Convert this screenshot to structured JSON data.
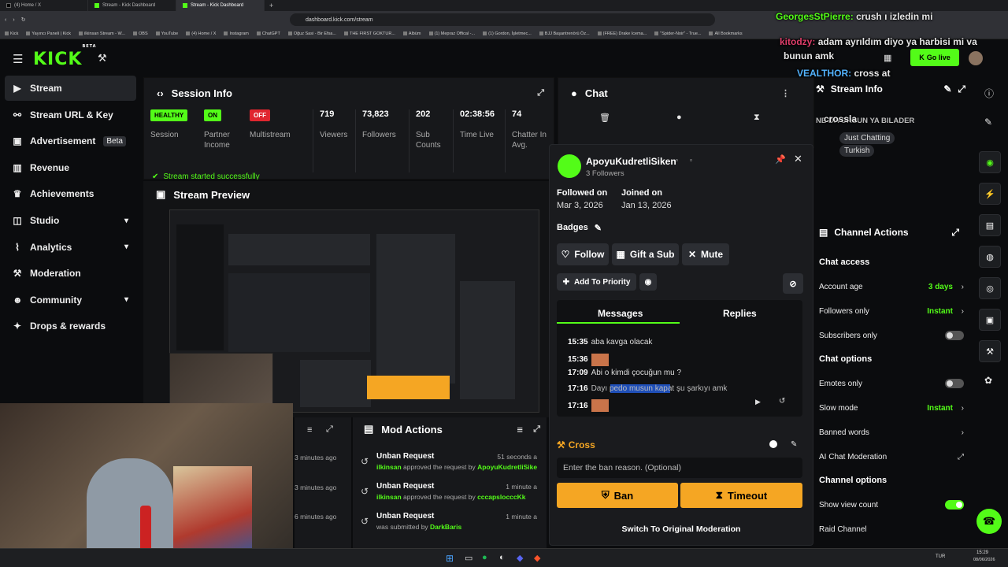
{
  "browser": {
    "tabs": [
      "(4) Home / X",
      "Stream - Kick Dashboard",
      "Stream - Kick Dashboard"
    ],
    "url": "dashboard.kick.com/stream",
    "bookmarks": [
      "Kick",
      "Yayıncı Paneli | Kick",
      "ilkinsan Stream - W...",
      "OBS",
      "YouTube",
      "(4) Home / X",
      "Instagram",
      "ChatGPT",
      "Oğuz Sasi - Bir Efsa...",
      "THE FIRST GOKTUR...",
      "Albüm",
      "(1) Mepraz Offical -...",
      "(1) Gordon, İşletmec...",
      "BJJ Başantrenörü Öz...",
      "(FREE) Drake Icema...",
      "\"Spider-Noir\" - True...",
      "All Bookmarks"
    ]
  },
  "header": {
    "logo": "KICK",
    "beta": "BETA",
    "go_live": "Go live"
  },
  "sidebar": {
    "items": [
      {
        "label": "Stream",
        "icon": "stream-icon",
        "glyph": "▶"
      },
      {
        "label": "Stream URL & Key",
        "icon": "link-icon",
        "glyph": "⚯"
      },
      {
        "label": "Advertisement",
        "icon": "advert-icon",
        "glyph": "▣",
        "badge": "Beta"
      },
      {
        "label": "Revenue",
        "icon": "revenue-icon",
        "glyph": "▥"
      },
      {
        "label": "Achievements",
        "icon": "trophy-icon",
        "glyph": "♛"
      },
      {
        "label": "Studio",
        "icon": "studio-icon",
        "glyph": "◫"
      },
      {
        "label": "Analytics",
        "icon": "analytics-icon",
        "glyph": "⌇"
      },
      {
        "label": "Moderation",
        "icon": "wrench-icon",
        "glyph": "⚒"
      },
      {
        "label": "Community",
        "icon": "community-icon",
        "glyph": "☻"
      },
      {
        "label": "Drops & rewards",
        "icon": "drops-icon",
        "glyph": "✦"
      }
    ]
  },
  "session": {
    "title": "Session Info",
    "health": "HEALTHY",
    "health_label": "Session",
    "partner": "ON",
    "partner_label": "Partner Income",
    "multistream": "OFF",
    "multistream_label": "Multistream",
    "viewers": "719",
    "viewers_label": "Viewers",
    "followers": "73,823",
    "followers_label": "Followers",
    "subs": "202",
    "subs_label": "Sub Counts",
    "time": "02:38:56",
    "time_label": "Time Live",
    "chatters": "74",
    "chatters_label": "Chatter In Avg.",
    "toast": "Stream started successfully"
  },
  "preview": {
    "title": "Stream Preview"
  },
  "chat_panel": {
    "title": "Chat"
  },
  "user_card": {
    "username": "ApoyuKudretliSiken",
    "followers": "3 Followers",
    "followed_label": "Followed on",
    "followed_date": "Mar 3, 2026",
    "joined_label": "Joined on",
    "joined_date": "Jan 13, 2026",
    "badges_label": "Badges",
    "follow": "Follow",
    "gift": "Gift a Sub",
    "mute": "Mute",
    "priority": "Add To Priority",
    "tab_messages": "Messages",
    "tab_replies": "Replies",
    "messages": [
      {
        "time": "15:35",
        "text": "aba kavga olacak"
      },
      {
        "time": "15:36",
        "text": ""
      },
      {
        "time": "17:09",
        "text": "Abi o kimdi çocuğun mu ?"
      },
      {
        "time": "17:16",
        "text": "Dayı pedo musun kapat şu şarkıyı amk"
      },
      {
        "time": "17:16",
        "text": ""
      }
    ],
    "cross_label": "Cross",
    "ban_placeholder": "Enter the ban reason. (Optional)",
    "ban": "Ban",
    "timeout": "Timeout",
    "switch": "Switch To Original Moderation"
  },
  "mod_actions": {
    "title": "Mod Actions",
    "left_times": [
      "3 minutes ago",
      "3 minutes ago",
      "6 minutes ago"
    ],
    "items": [
      {
        "title": "Unban Request",
        "time": "51 seconds a",
        "user": "ilkinsan",
        "mid": " approved the request by ",
        "target": "ApoyuKudretliSike"
      },
      {
        "title": "Unban Request",
        "time": "1 minute a",
        "user": "ilkinsan",
        "mid": " approved the request by ",
        "target": "cccapslocccKk"
      },
      {
        "title": "Unban Request",
        "time": "1 minute a",
        "user": "",
        "mid": "was submitted by ",
        "target": "DarkBaris"
      }
    ]
  },
  "stream_info": {
    "title": "Stream Info",
    "category": "NE DIYORSUN YA BILADER",
    "tag1": "Just Chatting",
    "tag2": "Turkish"
  },
  "channel_actions": {
    "title": "Channel Actions",
    "chat_access": "Chat access",
    "account_age": "Account age",
    "account_age_val": "3 days",
    "followers_only": "Followers only",
    "followers_only_val": "Instant",
    "subs_only": "Subscribers only",
    "chat_options": "Chat options",
    "emotes_only": "Emotes only",
    "slow_mode": "Slow mode",
    "slow_mode_val": "Instant",
    "banned_words": "Banned words",
    "ai_mod": "AI Chat Moderation",
    "channel_options": "Channel options",
    "show_view_count": "Show view count",
    "raid": "Raid Channel"
  },
  "overlay": {
    "line1_user": "GeorgesStPierre:",
    "line1_text": "crush ı izledin mi",
    "line2_user": "kitodzy:",
    "line2_text": "adam ayrıldım diyo ya harbisi mi va",
    "line3_text": "bunun amk",
    "line4_user": "VEALTHOR:",
    "line4_text": "cross at",
    "line5_text": "crossla"
  },
  "taskbar": {
    "lang": "TUR",
    "clock": "15:29",
    "date": "08/06/2026"
  },
  "colors": {
    "accent": "#53fc18",
    "ban": "#f5a623",
    "off": "#e0262f"
  }
}
